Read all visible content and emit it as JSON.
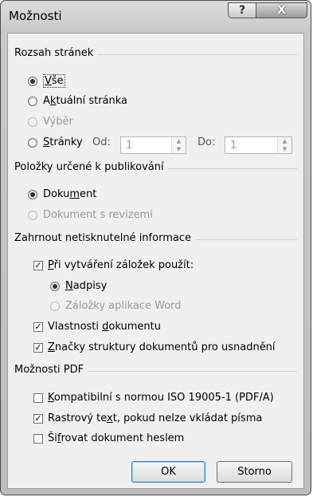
{
  "window": {
    "title": "Možnosti",
    "help_glyph": "?",
    "close_glyph": "X"
  },
  "page_range": {
    "label": "Rozsah stránek",
    "options": [
      {
        "prefix": "",
        "key": "V",
        "rest": "še",
        "selected": true,
        "enabled": true
      },
      {
        "prefix": "A",
        "key": "k",
        "rest": "tuální stránka",
        "selected": false,
        "enabled": true
      },
      {
        "prefix": "",
        "key": "",
        "rest": "Výběr",
        "selected": false,
        "enabled": false
      },
      {
        "prefix": "",
        "key": "S",
        "rest": "tránky",
        "selected": false,
        "enabled": true
      }
    ],
    "from_label": "Od:",
    "from_value": "1",
    "to_label": "Do:",
    "to_value": "1"
  },
  "publish": {
    "label": "Položky určené k publikování",
    "options": [
      {
        "prefix": "Doku",
        "key": "m",
        "rest": "ent",
        "selected": true,
        "enabled": true
      },
      {
        "prefix": "",
        "key": "",
        "rest": "Dokument s revizemi",
        "selected": false,
        "enabled": false
      }
    ]
  },
  "include": {
    "label": "Zahrnout netisknutelné informace",
    "bookmarks": {
      "prefix": "",
      "key": "P",
      "rest": "ři vytváření záložek použít:",
      "checked": true
    },
    "bookmark_options": [
      {
        "prefix": "",
        "key": "N",
        "rest": "adpisy",
        "selected": true,
        "enabled": true
      },
      {
        "prefix": "",
        "key": "",
        "rest": "Záložky aplikace Word",
        "selected": false,
        "enabled": false
      }
    ],
    "properties": {
      "prefix": "Vlastnosti ",
      "key": "d",
      "rest": "okumentu",
      "checked": true
    },
    "structure": {
      "prefix": "",
      "key": "Z",
      "rest": "načky struktury dokumentů pro usnadnění",
      "checked": true
    }
  },
  "pdf": {
    "label": "Možnosti PDF",
    "items": [
      {
        "prefix": "",
        "key": "K",
        "rest": "ompatibilní s normou ISO 19005-1 (PDF/A)",
        "checked": false
      },
      {
        "prefix": "Rastrový te",
        "key": "x",
        "rest": "t, pokud nelze vkládat písma",
        "checked": true
      },
      {
        "prefix": "Ši",
        "key": "f",
        "rest": "rovat dokument heslem",
        "checked": false
      }
    ]
  },
  "buttons": {
    "ok": "OK",
    "cancel": "Storno"
  },
  "check_glyph": "✓",
  "spin_up": "▲",
  "spin_down": "▼"
}
